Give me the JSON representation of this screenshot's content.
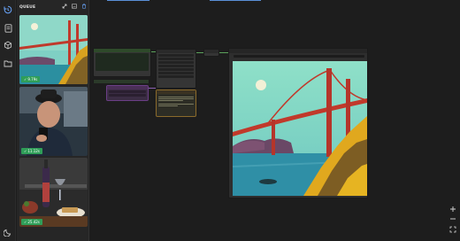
{
  "queue": {
    "title": "QUEUE",
    "items": [
      {
        "label": "Golden Gate Bridge",
        "time": "9.79s"
      },
      {
        "label": "Man in car",
        "time": "11.12s"
      },
      {
        "label": "Wine still life",
        "time": "25.42s"
      }
    ]
  },
  "icons": {
    "rail": [
      "history-icon",
      "document-icon",
      "cube-icon",
      "folder-icon",
      "moon-icon"
    ],
    "queue_header": [
      "expand-icon",
      "image-icon",
      "trash-icon"
    ],
    "canvas": [
      "zoom-in-icon",
      "zoom-out-icon",
      "fit-view-icon"
    ]
  },
  "colors": {
    "accent": "#6aa7ff",
    "badge": "#2f9e58",
    "wire": "#5aa05a"
  }
}
